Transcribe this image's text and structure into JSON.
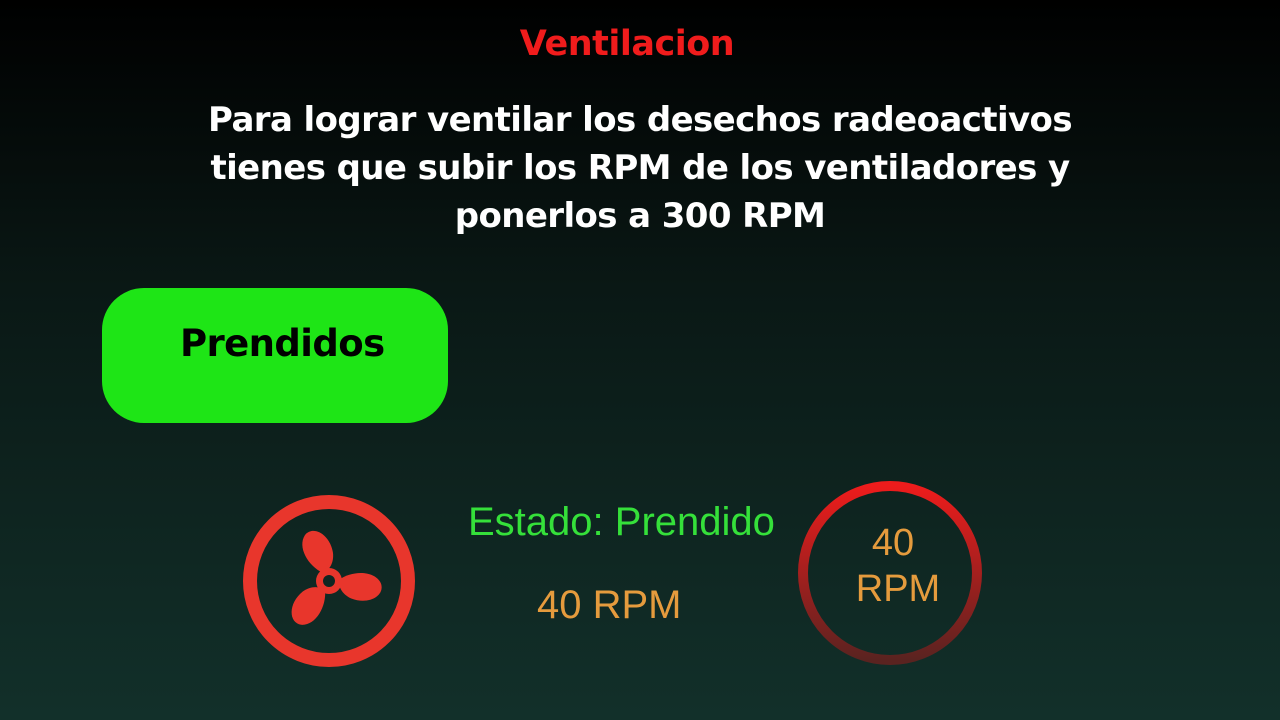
{
  "header": {
    "title": "Ventilacion",
    "description": "Para lograr ventilar los desechos radeoactivos  tienes que subir los RPM de los ventiladores y ponerlos a 300 RPM"
  },
  "toggle": {
    "label": "Prendidos",
    "color": "#1ee516"
  },
  "fan": {
    "icon": "fan-icon",
    "color": "#e8362c"
  },
  "status": {
    "text": "Estado: Prendido",
    "rpm_text": "40 RPM"
  },
  "gauge": {
    "value": "40",
    "unit": "RPM",
    "ring_colors": [
      "#ee1c1c",
      "#5a2320"
    ]
  },
  "colors": {
    "title": "#f01c1c",
    "rpm": "#e59b3d",
    "status": "#35e03a"
  }
}
